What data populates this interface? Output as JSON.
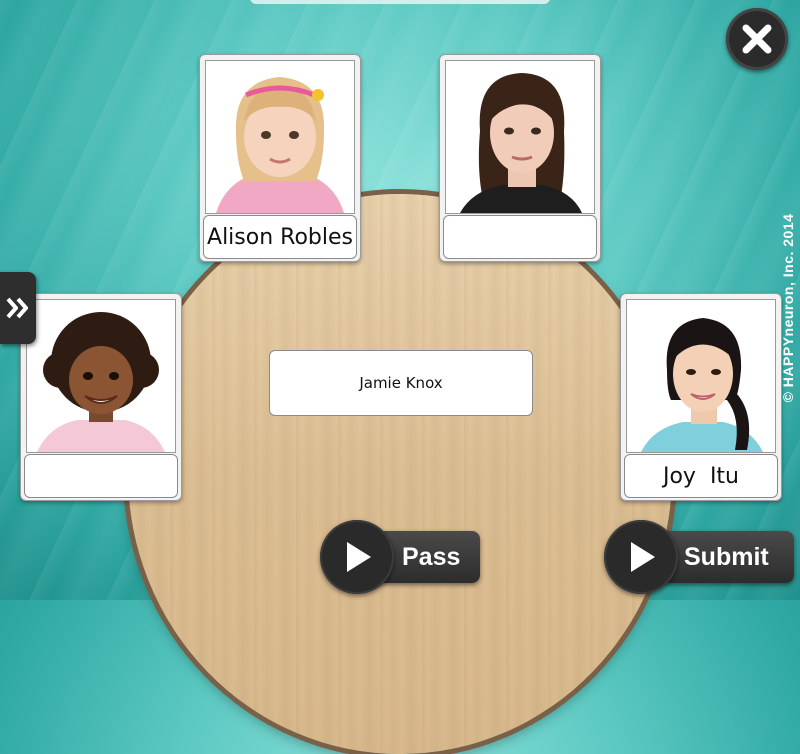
{
  "people": [
    {
      "id": "child-girl",
      "name": ""
    },
    {
      "id": "woman-dark-hair",
      "name": ""
    },
    {
      "id": "boy-curly-hair",
      "name": ""
    },
    {
      "id": "woman-ponytail",
      "name": ""
    }
  ],
  "cards": {
    "alison": {
      "label": "Alison Robles"
    },
    "woman": {
      "label": ""
    },
    "boy": {
      "label": ""
    },
    "joy": {
      "label": "Joy  Itu"
    }
  },
  "center_tag": {
    "label": "Jamie Knox"
  },
  "buttons": {
    "pass_label": "Pass",
    "submit_label": "Submit"
  },
  "icons": {
    "close": "close-icon",
    "side_toggle": "double-chevron-right-icon",
    "play": "play-icon"
  },
  "copyright": "© HAPPYneuron, Inc. 2014",
  "colors": {
    "background": "#5cc9c2",
    "table": "#dcbf94",
    "button": "#2c2c2c"
  }
}
